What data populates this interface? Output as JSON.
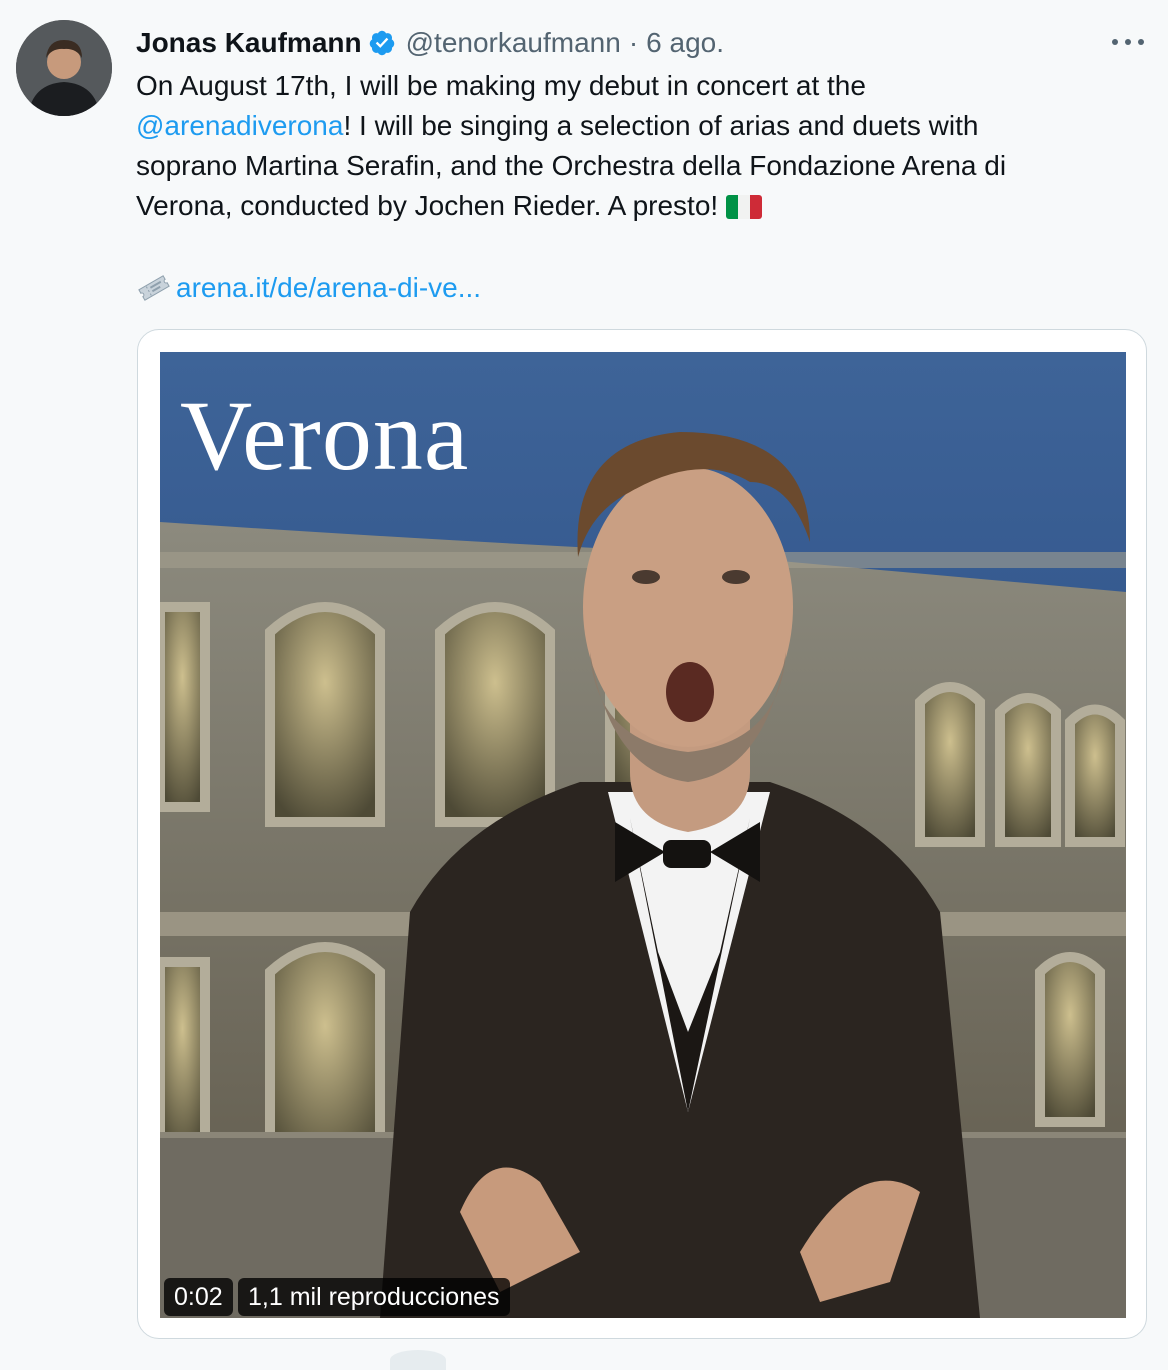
{
  "tweet": {
    "author_name": "Jonas Kaufmann",
    "author_handle": "@tenorkaufmann",
    "separator": "·",
    "timestamp": "6 ago.",
    "text_lines": {
      "l1": "On August 17th, I will be making my debut in concert at the",
      "l2_mention": "@arenadiverona",
      "l2_rest": "! I will be singing a selection of arias and duets with",
      "l3": "soprano Martina Serafin, and the Orchestra della Fondazione Arena di",
      "l4": "Verona, conducted by Jochen Rieder. A presto!"
    },
    "link_text": "arena.it/de/arena-di-ve...",
    "icons": {
      "verified": "verified-badge-icon",
      "more": "more-options-icon",
      "ticket": "ticket-emoji",
      "flag": "italy-flag-emoji"
    },
    "media": {
      "overlay_title": "Verona",
      "duration": "0:02",
      "views": "1,1 mil reproducciones"
    },
    "colors": {
      "link": "#1d9bf0",
      "secondary_text": "#536471",
      "verified": "#1d9bf0",
      "background": "#f7f9fa"
    }
  }
}
